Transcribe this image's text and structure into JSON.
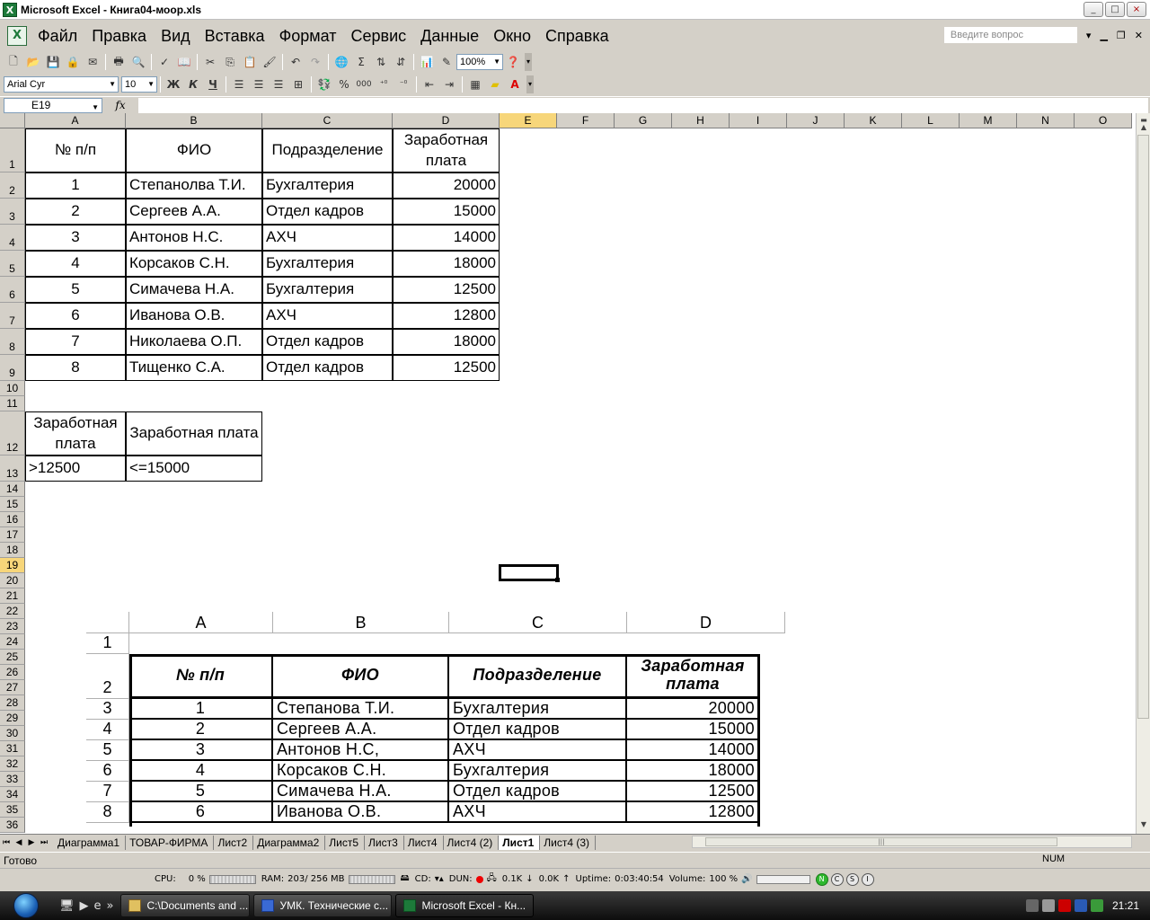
{
  "window": {
    "title": "Microsoft Excel - Книга04-моор.xls",
    "controls": [
      "_",
      "□",
      "×"
    ]
  },
  "menu": {
    "items": [
      "Файл",
      "Правка",
      "Вид",
      "Вставка",
      "Формат",
      "Сервис",
      "Данные",
      "Окно",
      "Справка"
    ],
    "help_placeholder": "Введите вопрос"
  },
  "toolbar": {
    "zoom": "100%",
    "font_name": "Arial Cyr",
    "font_size": "10",
    "bold": "Ж",
    "italic": "К",
    "underline": "Ч",
    "percent": "%",
    "thousands": "000",
    "sum": "Σ"
  },
  "formula_bar": {
    "cell_ref": "E19",
    "fx": "fx",
    "content": ""
  },
  "columns": [
    "A",
    "B",
    "C",
    "D",
    "E",
    "F",
    "G",
    "H",
    "I",
    "J",
    "K",
    "L",
    "M",
    "N",
    "O"
  ],
  "active_column": "E",
  "active_row": "19",
  "rows": [
    "1",
    "2",
    "3",
    "4",
    "5",
    "6",
    "7",
    "8",
    "9",
    "10",
    "11",
    "12",
    "13",
    "14",
    "15",
    "16",
    "17",
    "18",
    "19",
    "20",
    "21",
    "22",
    "23",
    "24",
    "25",
    "26",
    "27",
    "28",
    "29",
    "30",
    "31",
    "32",
    "33",
    "34",
    "35",
    "36"
  ],
  "table": {
    "headers": [
      "№ п/п",
      "ФИО",
      "Подразделение",
      "Заработная плата"
    ],
    "rows": [
      [
        "1",
        "Степанолва Т.И.",
        "Бухгалтерия",
        "20000"
      ],
      [
        "2",
        "Сергеев А.А.",
        "Отдел кадров",
        "15000"
      ],
      [
        "3",
        "Антонов Н.С.",
        "АХЧ",
        "14000"
      ],
      [
        "4",
        "Корсаков С.Н.",
        "Бухгалтерия",
        "18000"
      ],
      [
        "5",
        "Симачева Н.А.",
        "Бухгалтерия",
        "12500"
      ],
      [
        "6",
        "Иванова О.В.",
        "АХЧ",
        "12800"
      ],
      [
        "7",
        "Николаева О.П.",
        "Отдел кадров",
        "18000"
      ],
      [
        "8",
        "Тищенко С.А.",
        "Отдел кадров",
        "12500"
      ]
    ]
  },
  "criteria": {
    "headers": [
      "Заработная плата",
      "Заработная плата"
    ],
    "values": [
      ">12500",
      "<=15000"
    ]
  },
  "embedded_image": {
    "columns": [
      "A",
      "B",
      "C",
      "D"
    ],
    "rows": [
      "1",
      "2",
      "3",
      "4",
      "5",
      "6",
      "7",
      "8"
    ],
    "headers": [
      "№ п/п",
      "ФИО",
      "Подразделение",
      "Заработная плата"
    ],
    "data": [
      [
        "1",
        "Степанова Т.И.",
        "Бухгалтерия",
        "20000"
      ],
      [
        "2",
        "Сергеев А.А.",
        "Отдел кадров",
        "15000"
      ],
      [
        "3",
        "Антонов Н.С,",
        "АХЧ",
        "14000"
      ],
      [
        "4",
        "Корсаков С.Н.",
        "Бухгалтерия",
        "18000"
      ],
      [
        "5",
        "Симачева Н.А.",
        "Отдел кадров",
        "12500"
      ],
      [
        "6",
        "Иванова О.В.",
        "АХЧ",
        "12800"
      ]
    ]
  },
  "sheet_tabs": [
    "Диаграмма1",
    "ТОВАР-ФИРМА",
    "Лист2",
    "Диаграмма2",
    "Лист5",
    "Лист3",
    "Лист4",
    "Лист4 (2)",
    "Лист1",
    "Лист4 (3)"
  ],
  "active_sheet": "Лист1",
  "status": {
    "text": "Готово",
    "num": "NUM"
  },
  "monitor": {
    "cpu_label": "CPU:",
    "cpu_value": "0 %",
    "ram_label": "RAM:",
    "ram_value": "203/ 256 MB",
    "cd_label": "CD:",
    "dun_label": "DUN:",
    "down_rate": "0.1K",
    "up_rate": "0.0K",
    "uptime_label": "Uptime:",
    "uptime_value": "0:03:40:54",
    "volume_label": "Volume:",
    "volume_value": "100 %",
    "btn_n": "N",
    "btn_c": "C",
    "btn_s": "S",
    "btn_i": "I"
  },
  "taskbar": {
    "buttons": [
      "C:\\Documents and ...",
      "УМК. Технические с...",
      "Microsoft Excel - Кн..."
    ],
    "clock": "21:21"
  }
}
